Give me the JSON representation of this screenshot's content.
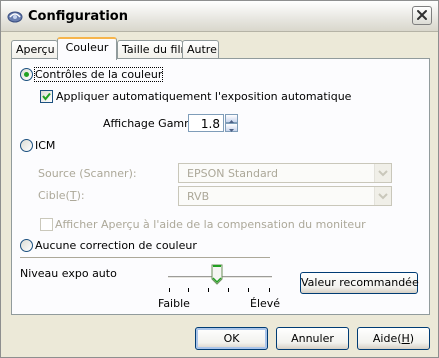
{
  "window": {
    "title": "Configuration",
    "app_icon": "scanner-app-icon",
    "close_icon": "close-x-icon"
  },
  "tabs": [
    {
      "label": "Aperçu",
      "active": false
    },
    {
      "label": "Couleur",
      "active": true
    },
    {
      "label": "Taille du film",
      "active": false
    },
    {
      "label": "Autre",
      "active": false
    }
  ],
  "color_controls": {
    "label": "Contrôles de la couleur",
    "selected": true,
    "auto_exposure_label": "Appliquer automatiquement l'exposition automatique",
    "auto_exposure_checked": true,
    "gamma_label": "Affichage Gamma:",
    "gamma_value": "1.8"
  },
  "icm": {
    "label": "ICM",
    "selected": false,
    "source_label": "Source (Scanner):",
    "source_value": "EPSON Standard",
    "target_label_pre": "Cible(",
    "target_label_key": "T",
    "target_label_post": "):",
    "target_value": "RVB",
    "preview_compensation_label": "Afficher Aperçu à l'aide de la compensation du moniteur",
    "preview_compensation_checked": false
  },
  "no_correction": {
    "label": "Aucune correction de couleur",
    "selected": false
  },
  "auto_exposure_level": {
    "label": "Niveau expo auto",
    "min_label": "Faible",
    "max_label": "Élevé",
    "level": 0.5,
    "recommended_button": "Valeur recommandée"
  },
  "buttons": {
    "ok": "OK",
    "cancel": "Annuler",
    "help_pre": "Aide(",
    "help_key": "H",
    "help_post": ")"
  },
  "colors": {
    "radio_dot": "#21a121",
    "check_mark": "#21a121",
    "focus_tab_border": "#f7b54c",
    "button_border": "#003c74"
  }
}
